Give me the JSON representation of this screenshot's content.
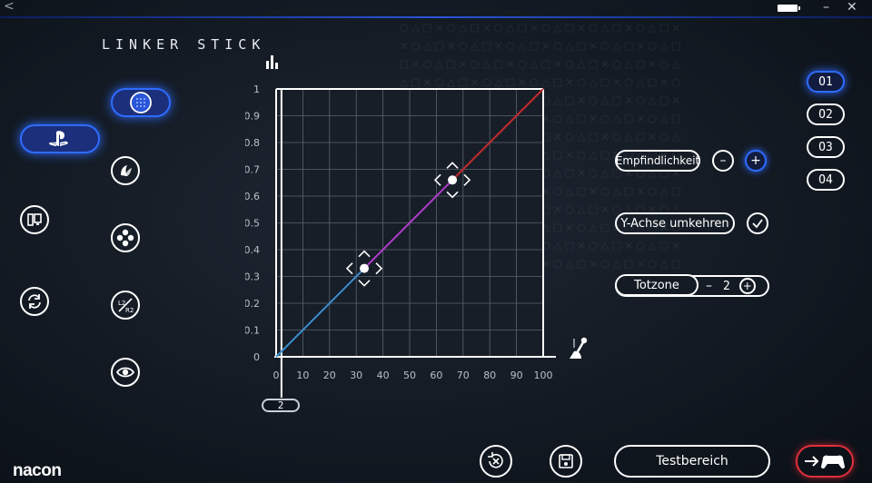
{
  "window": {
    "back_icon": "back-arrow-icon",
    "minimize_label": "–",
    "close_label": "✕"
  },
  "pattern_text": "○△□✕○△□✕○△□✕○△□✕○△□✕○△□✕\n✕○△□✕○△□✕○△□✕○△□✕○△□✕○△□\n□✕○△□✕○△□✕○△□✕○△□✕○△□✕○△\n△□✕○△□✕○△□✕○△□✕○△□✕○△□✕○\n○△□✕○△□✕○△□✕○△□✕○△□✕○△□✕\n✕○△□✕○△□✕○△□✕○△□✕○△□✕○△□\n□✕○△□✕○△□✕○△□✕○△□✕○△□✕○△\n△□✕○△□✕○△□✕○△□✕○△□✕○△□✕○\n○△□✕○△□✕○△□✕○△□✕○△□✕○△□✕\n✕○△□✕○△□✕○△□✕○△□✕○△□✕○△□\n□✕○△□✕○△□✕○△□✕○△□✕○△□✕○△\n△□✕○△□✕○△□✕○△□✕○△□✕○△□✕○\n○△□✕○△□✕○△□✕○△□✕○△□✕○△□✕\n✕○△□✕○△□✕○△□✕○△□✕○△□✕○△□",
  "page_title": "LINKER STICK",
  "left_nav": [
    "playstation-icon",
    "pc-console-icon",
    "sync-icon"
  ],
  "tools": [
    "left-stick-icon",
    "light-icon",
    "buttons-icon",
    "triggers-icon",
    "eye-icon"
  ],
  "profiles": [
    "O1",
    "O2",
    "O3",
    "O4"
  ],
  "active_profile": "O1",
  "settings": {
    "sensitivity_label": "Empfindlichkeit",
    "minus": "–",
    "plus": "+",
    "invert_y_label": "Y-Achse umkehren",
    "invert_y_checked": true,
    "deadzone_label": "Totzone",
    "deadzone_value": "2"
  },
  "bottom": {
    "testbereich_label": "Testbereich",
    "reset_icon": "reset-icon",
    "save_icon": "save-icon",
    "exit_icon": "exit-to-gamepad-icon"
  },
  "logo_text": "nacon",
  "chart_data": {
    "type": "line",
    "xlim": [
      0,
      100
    ],
    "ylim": [
      0,
      1
    ],
    "x_ticks": [
      "0",
      "10",
      "20",
      "30",
      "40",
      "50",
      "60",
      "70",
      "80",
      "90",
      "100"
    ],
    "y_ticks": [
      "0",
      "0.1",
      "0.2",
      "0.3",
      "0.4",
      "0.5",
      "0.6",
      "0.7",
      "0.8",
      "0.9",
      "1"
    ],
    "grid": true,
    "deadzone_x": 2,
    "control_points": [
      {
        "x": 33,
        "y": 0.33
      },
      {
        "x": 66,
        "y": 0.66
      }
    ],
    "segments": [
      {
        "from": [
          0,
          0
        ],
        "to": [
          33,
          0.33
        ],
        "color": "#3a8fd0"
      },
      {
        "from": [
          33,
          0.33
        ],
        "to": [
          66,
          0.66
        ],
        "color": "#b23ad0"
      },
      {
        "from": [
          66,
          0.66
        ],
        "to": [
          100,
          1
        ],
        "color": "#c62a2a"
      }
    ],
    "deadzone_marker_label": "2"
  }
}
